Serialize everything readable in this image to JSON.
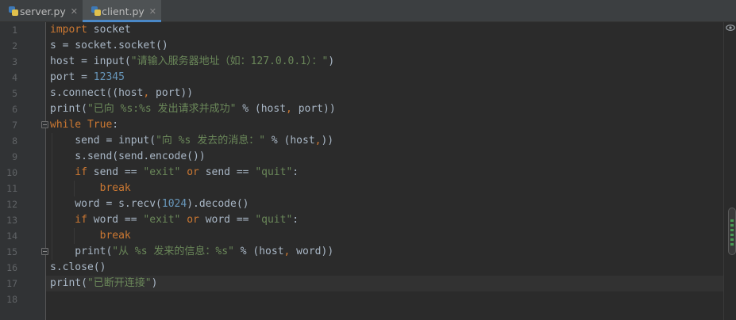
{
  "tabs": [
    {
      "name": "server.py",
      "active": false
    },
    {
      "name": "client.py",
      "active": true
    }
  ],
  "editor": {
    "line_numbers": [
      "1",
      "2",
      "3",
      "4",
      "5",
      "6",
      "7",
      "8",
      "9",
      "10",
      "11",
      "12",
      "13",
      "14",
      "15",
      "16",
      "17",
      "18"
    ],
    "current_line": 17,
    "code": {
      "l1_kw": "import",
      "l1_rest": " socket",
      "l2": "s = socket.socket()",
      "l3_a": "host = input(",
      "l3_str": "\"请输入服务器地址（如：127.0.0.1）：\"",
      "l3_b": ")",
      "l4_a": "port = ",
      "l4_num": "12345",
      "l5_a": "s.connect((host",
      "l5_comma": ",",
      "l5_b": " port))",
      "l6_a": "print(",
      "l6_str": "\"已向 %s:%s 发出请求并成功\"",
      "l6_b": " % (host",
      "l6_comma": ",",
      "l6_c": " port))",
      "l7_kw": "while",
      "l7_kw2": " True",
      "l7_b": ":",
      "l8_a": "    send = input(",
      "l8_str": "\"向 %s 发去的消息：\"",
      "l8_b": " % (host",
      "l8_comma": ",",
      "l8_c": "))",
      "l9": "    s.send(send.encode())",
      "l10_kw": "    if",
      "l10_a": " send == ",
      "l10_str1": "\"exit\"",
      "l10_or": " or",
      "l10_b": " send == ",
      "l10_str2": "\"quit\"",
      "l10_c": ":",
      "l11_kw": "        break",
      "l12_a": "    word = s.recv(",
      "l12_num": "1024",
      "l12_b": ").decode()",
      "l13_kw": "    if",
      "l13_a": " word == ",
      "l13_str1": "\"exit\"",
      "l13_or": " or",
      "l13_b": " word == ",
      "l13_str2": "\"quit\"",
      "l13_c": ":",
      "l14_kw": "        break",
      "l15_a": "    print(",
      "l15_str": "\"从 %s 发来的信息：%s\"",
      "l15_b": " % (host",
      "l15_comma": ",",
      "l15_c": " word))",
      "l16": "s.close()",
      "l17_a": "print(",
      "l17_str": "\"已断开连接\"",
      "l17_b": ")"
    }
  },
  "icons": {
    "tab_file": "python-file-icon",
    "tab_close": "close-icon",
    "preview": "eye-icon",
    "fold": "fold-marker-icon"
  },
  "tab_close_glyph": "✕",
  "colors": {
    "background": "#2b2b2b",
    "keyword": "#cc7832",
    "string": "#6a8759",
    "number": "#6897bb",
    "text": "#a9b7c6",
    "tab_active_underline": "#4a88c7"
  }
}
